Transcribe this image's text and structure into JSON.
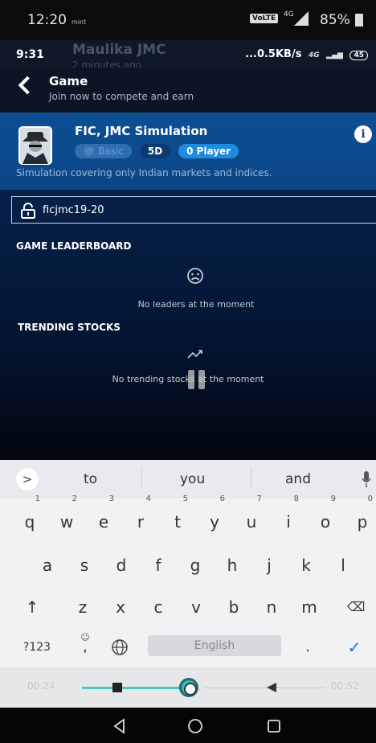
{
  "outer_status": {
    "time": "12:20",
    "carrier_mini": "mint",
    "volte": "VoLTE",
    "net": "4G",
    "battery": "85%"
  },
  "inner_status": {
    "time": "9:31",
    "ghost_name": "Maulika JMC",
    "ghost_sub": "2 minutes ago",
    "net_speed": "...0.5KB/s",
    "net_badge": "4G",
    "battery": "45"
  },
  "header": {
    "title": "Game",
    "subtitle": "Join now to compete and earn"
  },
  "card": {
    "title": "FIC, JMC Simulation",
    "badge_basic": "Basic",
    "badge_days": "5D",
    "badge_players": "0 Player",
    "description": "Simulation covering only Indian markets and indices.",
    "info_glyph": "i"
  },
  "code_input": {
    "value": "ficjmc19-20"
  },
  "leaderboard": {
    "title": "GAME LEADERBOARD",
    "empty": "No leaders at the moment"
  },
  "trending": {
    "title": "TRENDING STOCKS",
    "empty": "No trending stocks at the moment"
  },
  "keyboard": {
    "expand": ">",
    "suggestions": [
      "to",
      "you",
      "and"
    ],
    "row1": [
      "q",
      "w",
      "e",
      "r",
      "t",
      "y",
      "u",
      "i",
      "o",
      "p"
    ],
    "row1_hints": [
      "1",
      "2",
      "3",
      "4",
      "5",
      "6",
      "7",
      "8",
      "9",
      "0"
    ],
    "row2": [
      "a",
      "s",
      "d",
      "f",
      "g",
      "h",
      "j",
      "k",
      "l"
    ],
    "row3": [
      "z",
      "x",
      "c",
      "v",
      "b",
      "n",
      "m"
    ],
    "shift": "↑",
    "backspace": "⌫",
    "mode_key": "?123",
    "comma": ",",
    "emoji_hint": "☺",
    "space_label": "English",
    "period": ".",
    "enter": "✓"
  },
  "player": {
    "elapsed": "00:24",
    "total": "00:52",
    "progress": 0.46
  },
  "colors": {
    "card_blue": "#0b4687",
    "badge_blue": "#1e8ae0",
    "teal": "#52c3c3",
    "enter_blue": "#1a73e8"
  }
}
